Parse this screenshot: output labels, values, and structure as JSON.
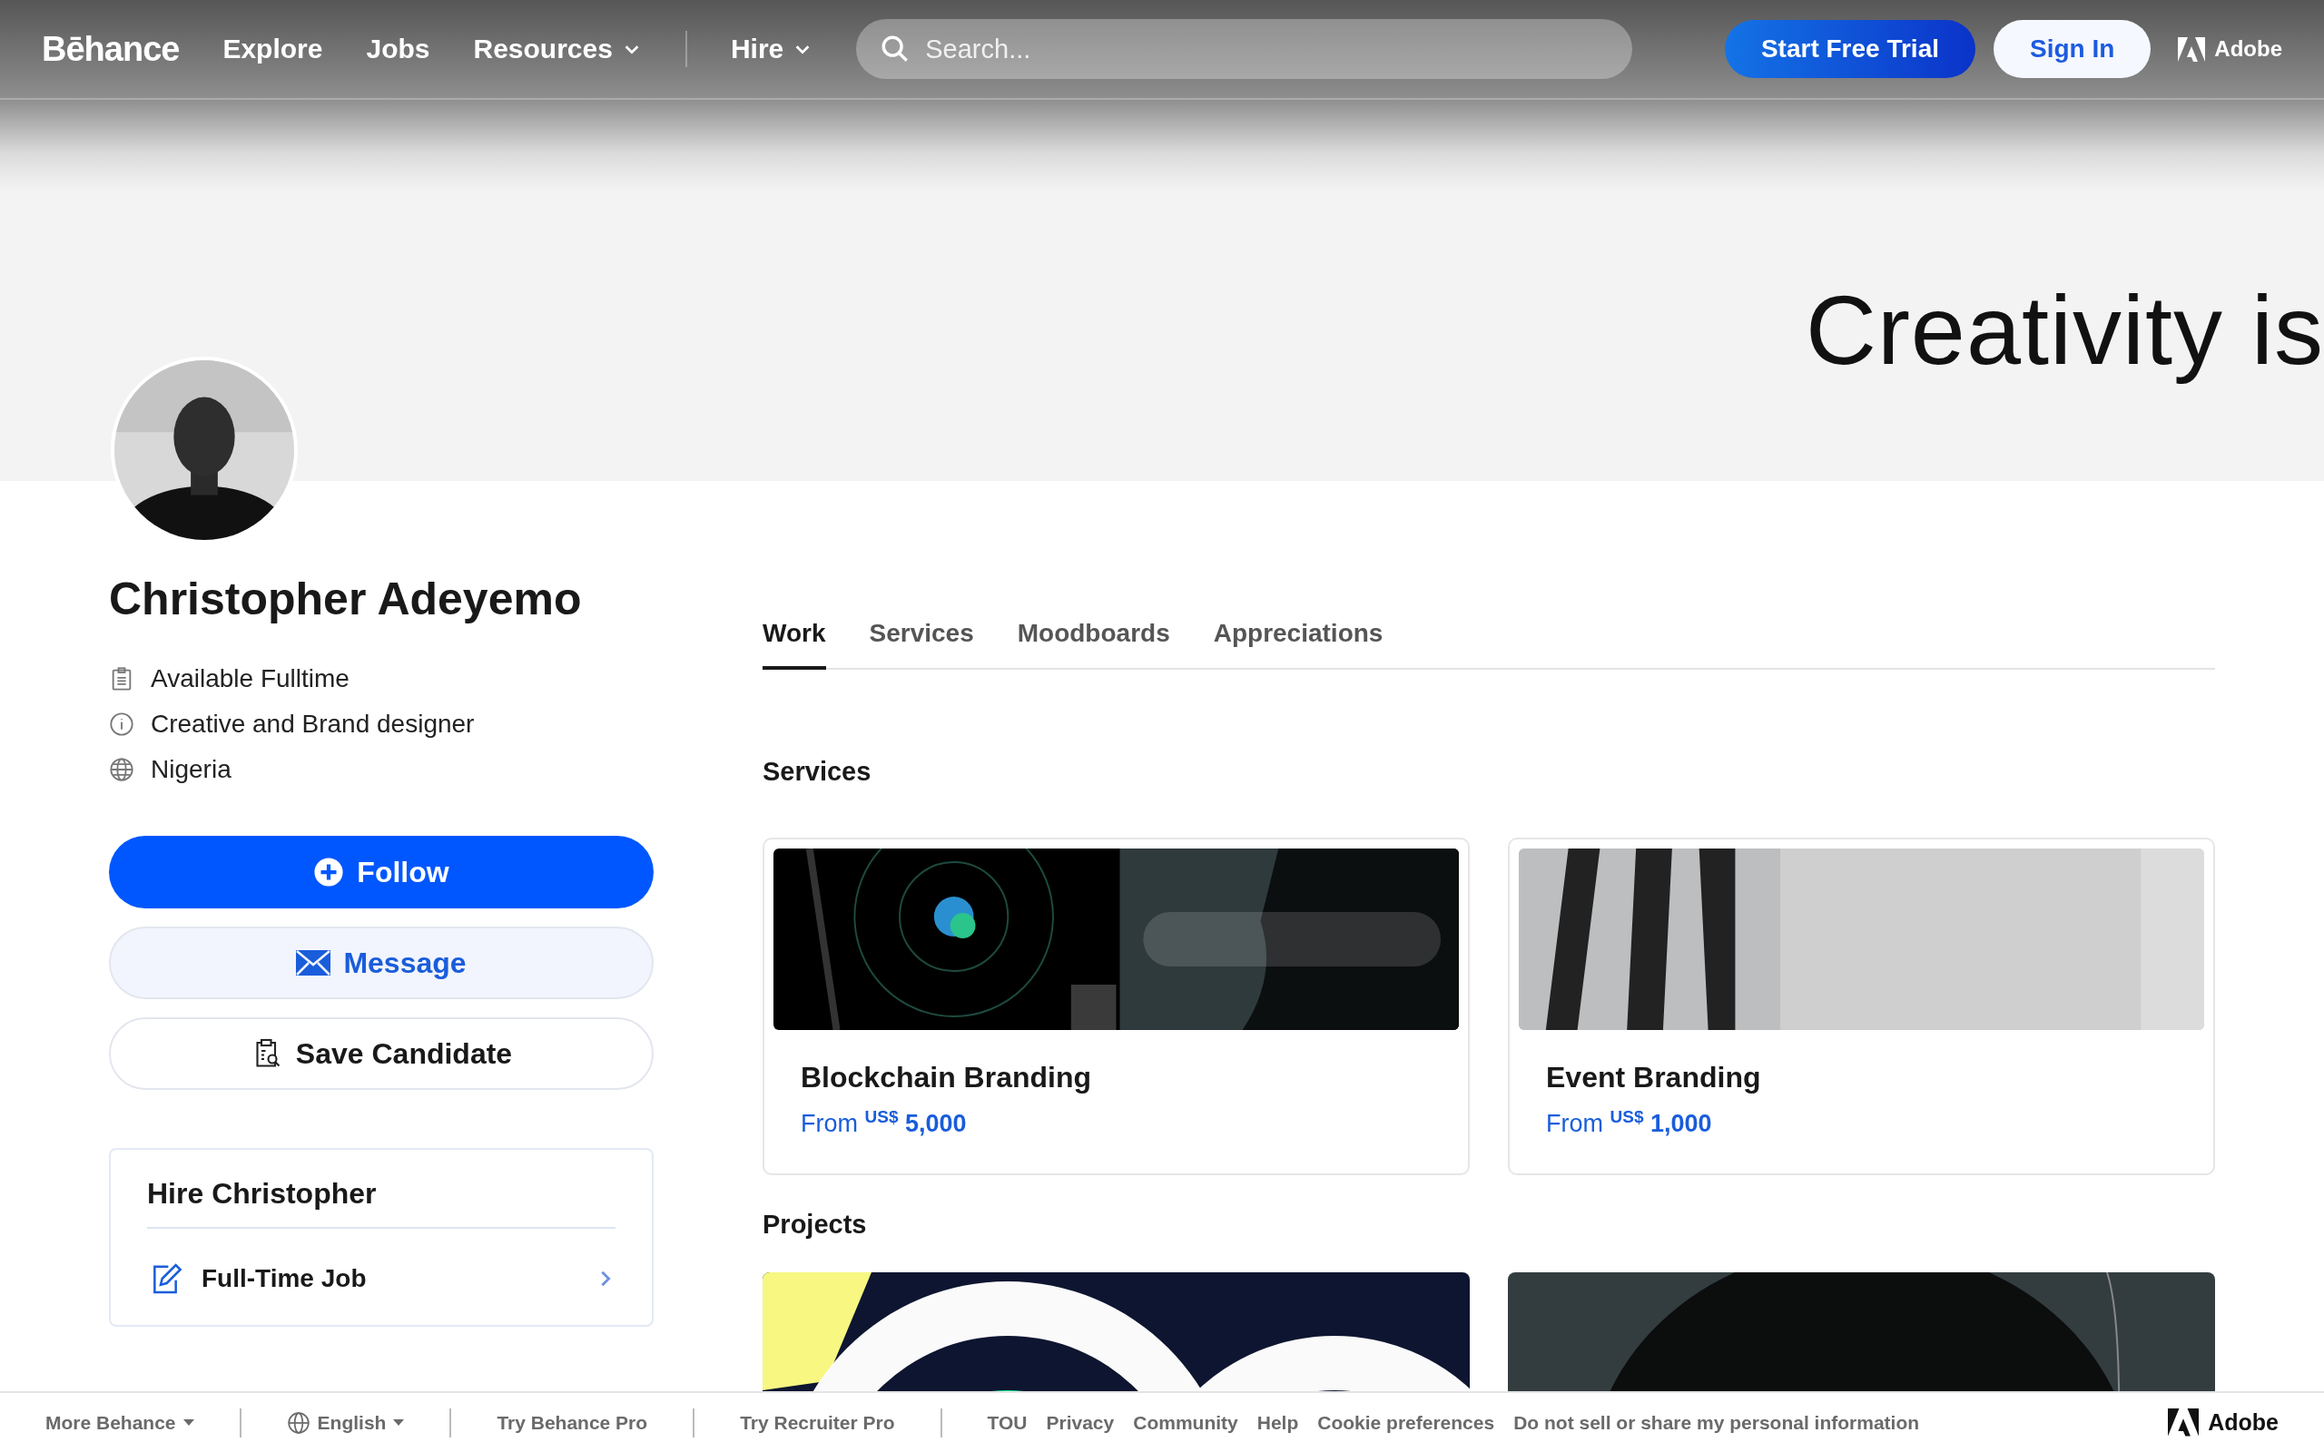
{
  "header": {
    "logo": "Bēhance",
    "nav": [
      {
        "label": "Explore",
        "dropdown": false
      },
      {
        "label": "Jobs",
        "dropdown": false
      },
      {
        "label": "Resources",
        "dropdown": true
      }
    ],
    "hire": {
      "label": "Hire",
      "dropdown": true
    },
    "search": {
      "placeholder": "Search..."
    },
    "buttons": [
      {
        "label": "Start Free Trial",
        "kind": "primary"
      },
      {
        "label": "Sign In",
        "kind": "secondary"
      }
    ],
    "brand": "Adobe"
  },
  "banner": {
    "text": "Creativity is"
  },
  "profile": {
    "name": "Christopher Adeyemo",
    "details": [
      {
        "kind": "availability",
        "text": "Available Fulltime"
      },
      {
        "kind": "info",
        "text": "Creative and Brand designer"
      },
      {
        "kind": "location",
        "text": "Nigeria"
      }
    ],
    "actions": [
      {
        "kind": "follow",
        "label": "Follow"
      },
      {
        "kind": "message",
        "label": "Message"
      },
      {
        "kind": "save",
        "label": "Save Candidate"
      }
    ],
    "hire": {
      "title": "Hire Christopher",
      "options": [
        "Full-Time Job"
      ]
    }
  },
  "tabs": [
    {
      "label": "Work",
      "selected": true
    },
    {
      "label": "Services",
      "selected": false
    },
    {
      "label": "Moodboards",
      "selected": false
    },
    {
      "label": "Appreciations",
      "selected": false
    }
  ],
  "services": {
    "title": "Services",
    "items": [
      {
        "title": "Blockchain Branding",
        "prefix": "From",
        "currency": "US$",
        "amount": "5,000",
        "kind": "picture"
      },
      {
        "title": "Event Branding",
        "prefix": "From",
        "currency": "US$",
        "amount": "1,000",
        "kind": "picture"
      }
    ]
  },
  "projects": {
    "title": "Projects"
  },
  "footer": {
    "groups": [
      [
        {
          "label": "More Behance",
          "dropdown": true,
          "globe": false
        }
      ],
      [
        {
          "label": "English",
          "dropdown": true,
          "globe": true
        }
      ],
      [
        {
          "label": "Try Behance Pro",
          "dropdown": false,
          "globe": false
        }
      ],
      [
        {
          "label": "Try Recruiter Pro",
          "dropdown": false,
          "globe": false
        }
      ],
      [
        {
          "label": "TOU",
          "dropdown": false,
          "globe": false
        },
        {
          "label": "Privacy",
          "dropdown": false,
          "globe": false
        },
        {
          "label": "Community",
          "dropdown": false,
          "globe": false
        },
        {
          "label": "Help",
          "dropdown": false,
          "globe": false
        },
        {
          "label": "Cookie preferences",
          "dropdown": false,
          "globe": false
        },
        {
          "label": "Do not sell or share my personal information",
          "dropdown": false,
          "globe": false
        }
      ]
    ],
    "brand": "Adobe"
  }
}
